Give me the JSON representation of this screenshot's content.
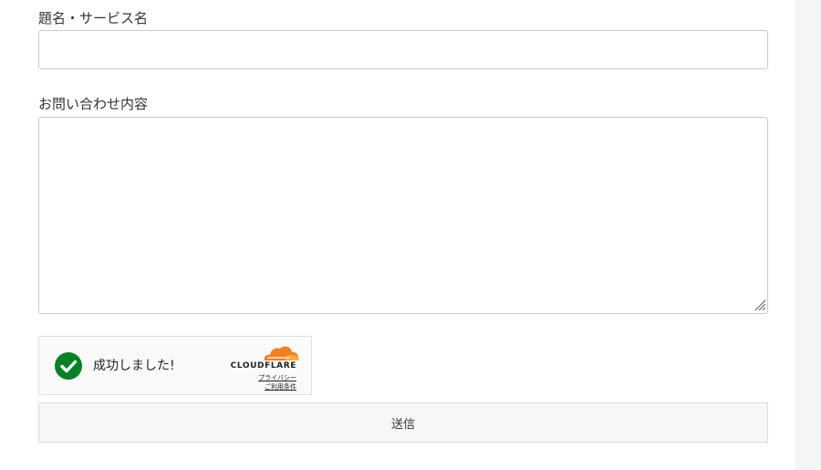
{
  "form": {
    "title_label": "題名・サービス名",
    "title_value": "",
    "content_label": "お問い合わせ内容",
    "content_value": ""
  },
  "captcha": {
    "status_text": "成功しました!",
    "provider": "CLOUDFLARE",
    "privacy_link": "プライバシー",
    "terms_link": "ご利用条件",
    "success_color": "#038127",
    "brand_orange": "#f38020",
    "brand_light_orange": "#faae40",
    "status_icon": "checkmark-circle-icon",
    "logo_icon": "cloudflare-cloud-icon"
  },
  "submit": {
    "label": "送信"
  }
}
